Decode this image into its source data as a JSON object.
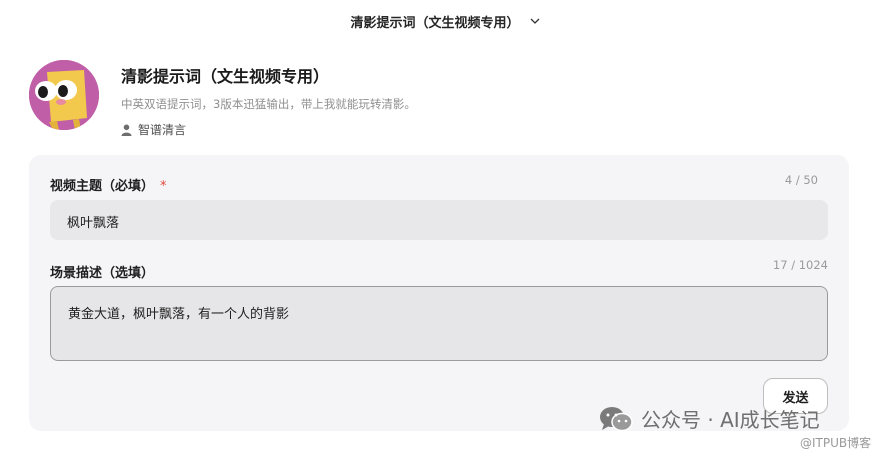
{
  "header": {
    "title": "清影提示词（文生视频专用）"
  },
  "agent": {
    "name": "清影提示词（文生视频专用）",
    "description": "中英双语提示词，3版本迅猛输出，带上我就能玩转清影。",
    "author": "智谱清言"
  },
  "form": {
    "topic": {
      "label": "视频主题（必填）",
      "required_mark": "*",
      "counter": "4 / 50",
      "value": "枫叶飘落"
    },
    "scene": {
      "label": "场景描述（选填）",
      "counter": "17 / 1024",
      "value": "黄金大道，枫叶飘落，有一个人的背影"
    },
    "send_label": "发送"
  },
  "watermark": {
    "text": "公众号 · AI成长笔记",
    "sub": "@ITPUB博客"
  },
  "colors": {
    "avatar_bg": "#c05fa8",
    "required": "#e0473f",
    "card_bg": "#f5f5f7"
  }
}
